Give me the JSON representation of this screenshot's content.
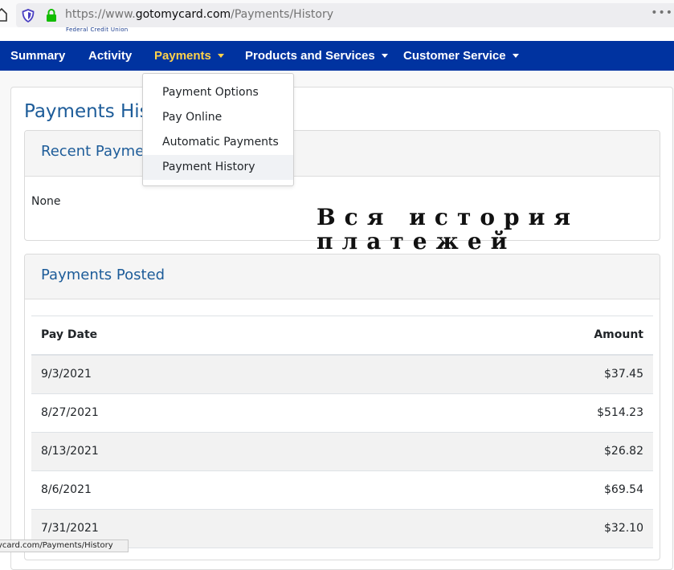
{
  "browser": {
    "url_scheme": "https://www.",
    "url_host": "gotomycard.com",
    "url_path": "/Payments/History",
    "more": "•••",
    "status_url": "ycard.com/Payments/History"
  },
  "brand": {
    "tagline": "Federal Credit Union",
    "nav_bg": "#0033a0",
    "active_color": "#ffd24a",
    "title_color": "#1d5c99"
  },
  "nav": {
    "items": [
      "Summary",
      "Activity",
      "Payments",
      "Products and Services",
      "Customer Service"
    ],
    "active": "Payments"
  },
  "dropdown": {
    "items": [
      "Payment Options",
      "Pay Online",
      "Automatic Payments",
      "Payment History"
    ],
    "highlighted": "Payment History"
  },
  "page": {
    "title": "Payments History"
  },
  "recent": {
    "title": "Recent Payments",
    "body": "None"
  },
  "posted": {
    "title": "Payments Posted",
    "columns": [
      "Pay Date",
      "Amount"
    ],
    "rows": [
      [
        "9/3/2021",
        "$37.45"
      ],
      [
        "8/27/2021",
        "$514.23"
      ],
      [
        "8/13/2021",
        "$26.82"
      ],
      [
        "8/6/2021",
        "$69.54"
      ],
      [
        "7/31/2021",
        "$32.10"
      ]
    ]
  },
  "overlay": {
    "line1": "Вся история",
    "line2": "платежей"
  },
  "icons": [
    "home-icon",
    "shield-icon",
    "lock-icon",
    "caret-down-icon"
  ]
}
